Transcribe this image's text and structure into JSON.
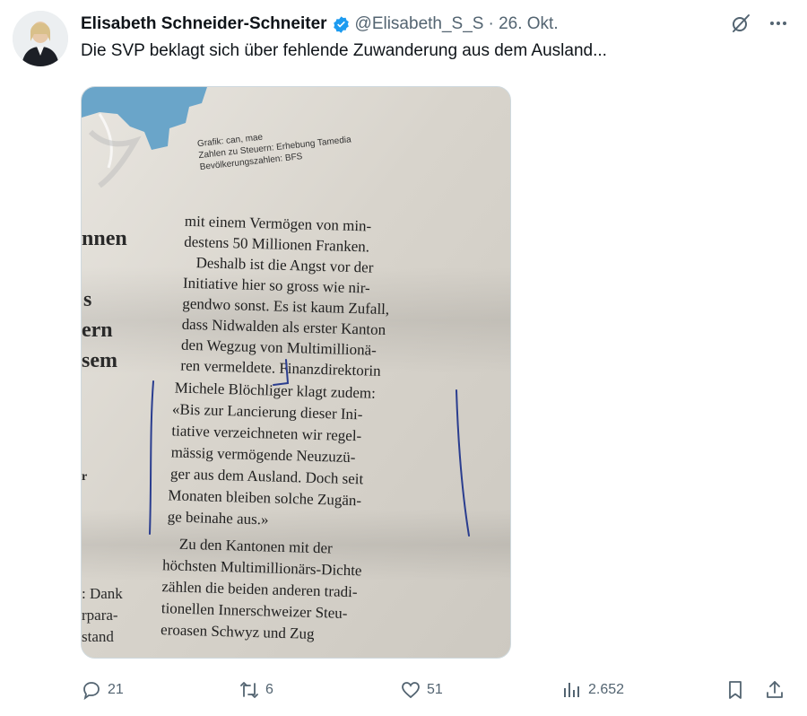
{
  "author": {
    "name": "Elisabeth Schneider-Schneiter",
    "handle": "@Elisabeth_S_S",
    "date": "· 26. Okt."
  },
  "tweet": {
    "text": "Die SVP beklagt sich über fehlende Zuwanderung aus dem Ausland..."
  },
  "newspaper": {
    "credit": [
      "Grafik: can, mae",
      "Zahlen zu Steuern: Erhebung Tamedia",
      "Bevölkerungszahlen: BFS"
    ],
    "main_lines": [
      "mit einem Vermögen von min-",
      "destens 50 Millionen Franken.",
      "Deshalb ist die Angst vor der",
      "Initiative hier so gross wie nir-",
      "gendwo sonst. Es ist kaum Zufall,",
      "dass Nidwalden als erster Kanton",
      "den Wegzug von Multimillionä-",
      "ren vermeldete. Finanzdirektorin",
      "Michele Blöchliger klagt zudem:",
      "«Bis zur Lancierung dieser Ini-",
      "tiative verzeichneten wir regel-",
      "mässig vermögende Neuzuzü-",
      "ger aus dem Ausland. Doch seit",
      "Monaten bleiben solche Zugän-",
      "ge beinahe aus.»",
      "Zu den Kantonen mit der",
      "höchsten Multimillionärs-Dichte",
      "zählen die beiden anderen tradi-",
      "tionellen Innerschweizer Steu-",
      "eroasen Schwyz und Zug"
    ],
    "left_fragments_top": [
      "nnen",
      "s",
      "ern",
      "sem",
      "r"
    ],
    "left_fragments_bottom": [
      ": Dank",
      "rpara-",
      "stand"
    ]
  },
  "stats": {
    "replies": "21",
    "reposts": "6",
    "likes": "51",
    "views": "2.652"
  },
  "colors": {
    "verified_blue": "#1d9bf0",
    "icon_grey": "#536471",
    "map_blue": "#6aa5c9",
    "pen_blue": "#2a3d8f"
  },
  "icons": {
    "grok": "grok-icon",
    "more": "more-icon",
    "reply": "reply-icon",
    "retweet": "retweet-icon",
    "like": "heart-icon",
    "views": "views-icon",
    "bookmark": "bookmark-icon",
    "share": "share-icon"
  }
}
